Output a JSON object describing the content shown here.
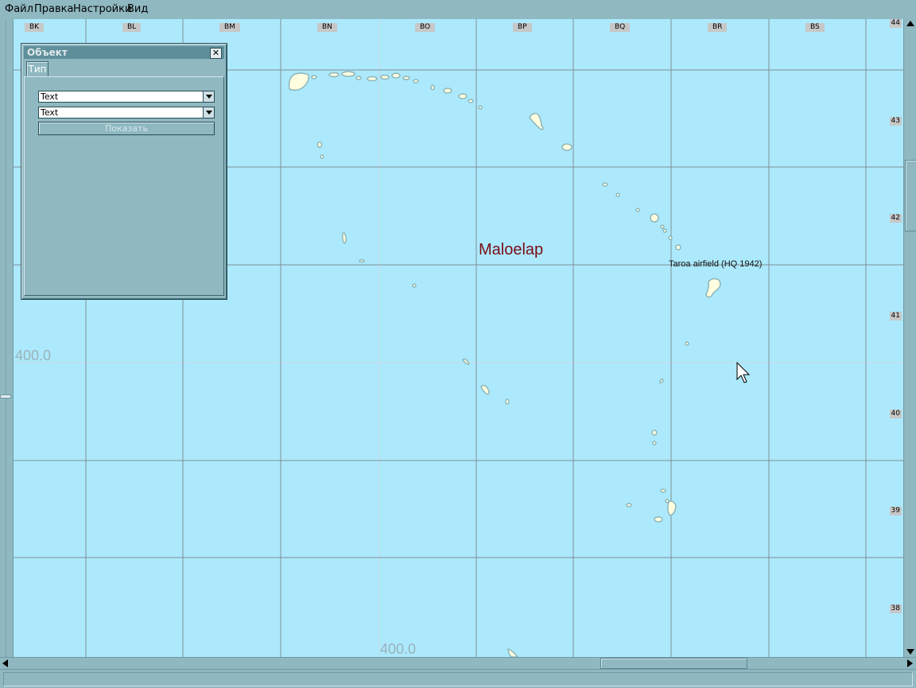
{
  "menu": [
    "Файл",
    "Правка",
    "Настройки",
    "Вид"
  ],
  "map": {
    "columns": [
      "BK",
      "BL",
      "BM",
      "BN",
      "BO",
      "BP",
      "BQ",
      "BR",
      "BS"
    ],
    "rows": [
      "44",
      "43",
      "42",
      "41",
      "40",
      "39",
      "38"
    ],
    "coord_left": "400.0",
    "coord_bottom": "400.0",
    "place_name": "Maloelap",
    "poi_label": "Taroa airfield (HQ 1942)",
    "colors": {
      "water": "#ace9fd",
      "land": "#fffde0",
      "grid": "#7f8e95",
      "place": "#7a0d16"
    }
  },
  "panel": {
    "title": "Объект",
    "close_glyph": "✕",
    "tab": "Тип",
    "select1_value": "Text",
    "select2_value": "Text",
    "show_button": "Показать"
  }
}
